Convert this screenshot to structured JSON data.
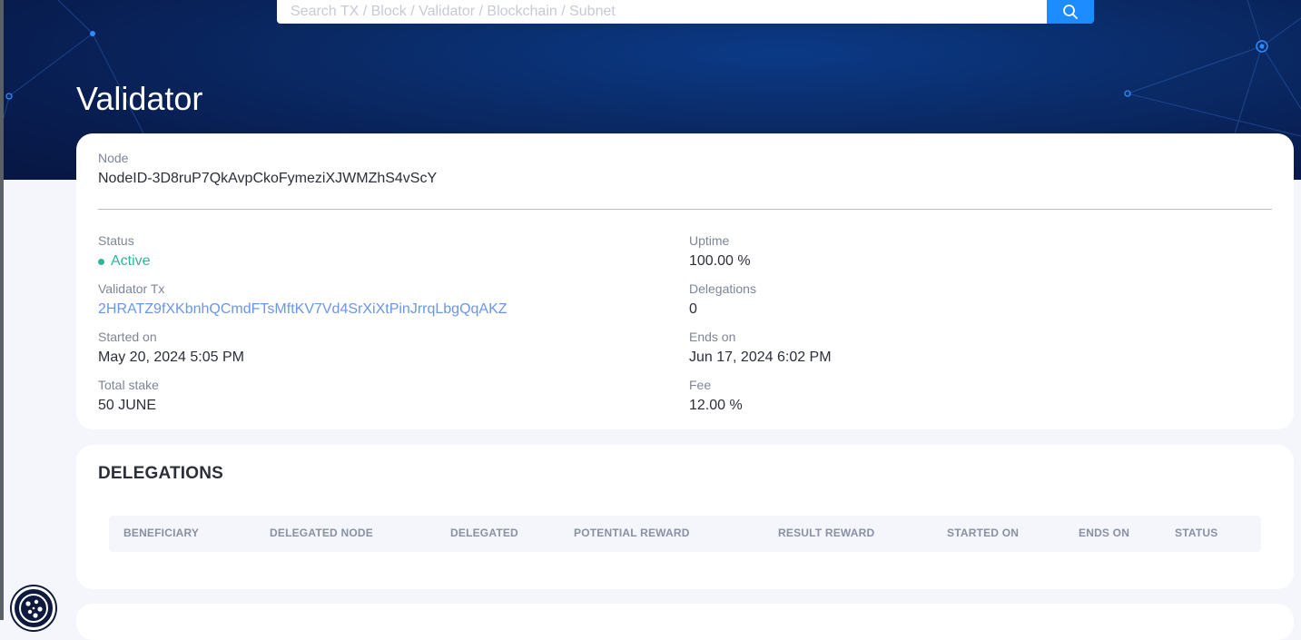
{
  "search": {
    "placeholder": "Search TX / Block / Validator / Blockchain / Subnet"
  },
  "page": {
    "title": "Validator"
  },
  "validator": {
    "node_label": "Node",
    "node_value": "NodeID-3D8ruP7QkAvpCkoFymeziXJWMZhS4vScY",
    "status_label": "Status",
    "status_value": "Active",
    "validator_tx_label": "Validator Tx",
    "validator_tx_value": "2HRATZ9fXKbnhQCmdFTsMftKV7Vd4SrXiXtPinJrrqLbgQqAKZ",
    "started_label": "Started on",
    "started_value": "May 20, 2024 5:05 PM",
    "total_stake_label": "Total stake",
    "total_stake_value": "50 JUNE",
    "uptime_label": "Uptime",
    "uptime_value": "100.00 %",
    "delegations_label": "Delegations",
    "delegations_value": "0",
    "ends_label": "Ends on",
    "ends_value": "Jun 17, 2024 6:02 PM",
    "fee_label": "Fee",
    "fee_value": "12.00 %"
  },
  "delegations": {
    "title": "DELEGATIONS",
    "columns": [
      "BENEFICIARY",
      "DELEGATED NODE",
      "DELEGATED",
      "POTENTIAL REWARD",
      "RESULT REWARD",
      "STARTED ON",
      "ENDS ON",
      "STATUS"
    ]
  },
  "icons": {
    "search": "search-icon",
    "status_dot": "status-dot-icon",
    "cookie": "cookie-icon"
  },
  "colors": {
    "hero_bg": "#0a2a66",
    "accent": "#1d8cff",
    "active": "#2fb59a",
    "link": "#6b96e8"
  }
}
